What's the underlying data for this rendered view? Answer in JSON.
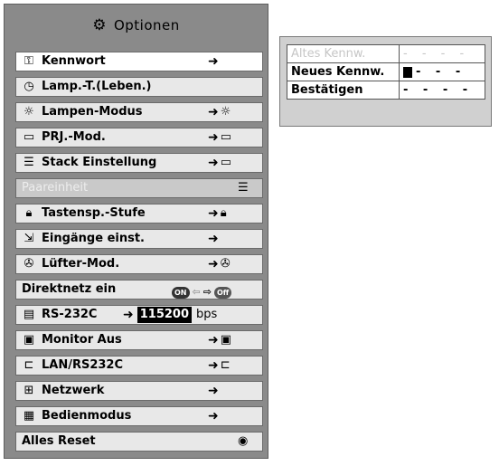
{
  "menu": {
    "title": "Optionen",
    "title_icon": "gears-icon",
    "items": [
      {
        "label": "Kennwort",
        "icon": "key-icon",
        "arrow": "➜",
        "right_icon": "",
        "selected": true
      },
      {
        "label": "Lamp.-T.(Leben.)",
        "icon": "lamp-timer-icon",
        "arrow": "",
        "right_icon": ""
      },
      {
        "label": "Lampen-Modus",
        "icon": "lamp-icon",
        "arrow": "➜",
        "right_icon": "lamp-mode-icon"
      },
      {
        "label": "PRJ.-Mod.",
        "icon": "projection-icon",
        "arrow": "➜",
        "right_icon": "projection-icon"
      },
      {
        "label": "Stack Einstellung",
        "icon": "stack-icon",
        "arrow": "➜",
        "right_icon": "stack-setting-icon"
      },
      {
        "label": "Paareinheit",
        "icon": "",
        "arrow": "",
        "right_icon": "pair-icon",
        "disabled": true
      },
      {
        "label": "Tastensp.-Stufe",
        "icon": "lock-icon",
        "arrow": "➜",
        "right_icon": "lock-icon"
      },
      {
        "label": "Eingänge einst.",
        "icon": "input-icon",
        "arrow": "➜",
        "right_icon": ""
      },
      {
        "label": "Lüfter-Mod.",
        "icon": "fan-icon",
        "arrow": "➜",
        "right_icon": "fan-icon"
      },
      {
        "label": "Direktnetz ein",
        "icon": "",
        "on_label": "ON",
        "off_label": "Off"
      },
      {
        "label": "RS-232C",
        "icon": "rs232-icon",
        "arrow": "➜",
        "baud": "115200",
        "unit": "bps"
      },
      {
        "label": "Monitor Aus",
        "icon": "monitor-icon",
        "arrow": "➜",
        "right_icon": "monitor-icon"
      },
      {
        "label": "LAN/RS232C",
        "icon": "lan-icon",
        "arrow": "➜",
        "right_icon": "lan-icon"
      },
      {
        "label": "Netzwerk",
        "icon": "network-icon",
        "arrow": "➜",
        "right_icon": ""
      },
      {
        "label": "Bedienmodus",
        "icon": "operation-icon",
        "arrow": "➜",
        "right_icon": ""
      },
      {
        "label": "Alles Reset",
        "icon": "",
        "arrow": "",
        "right_icon": "reset-icon"
      }
    ]
  },
  "password": {
    "rows": [
      {
        "label": "Altes Kennw.",
        "value": "- - - -",
        "dim": true
      },
      {
        "label": "Neues Kennw.",
        "value": "- - -",
        "cursor": true
      },
      {
        "label": "Bestätigen",
        "value": "- - - -"
      }
    ]
  }
}
